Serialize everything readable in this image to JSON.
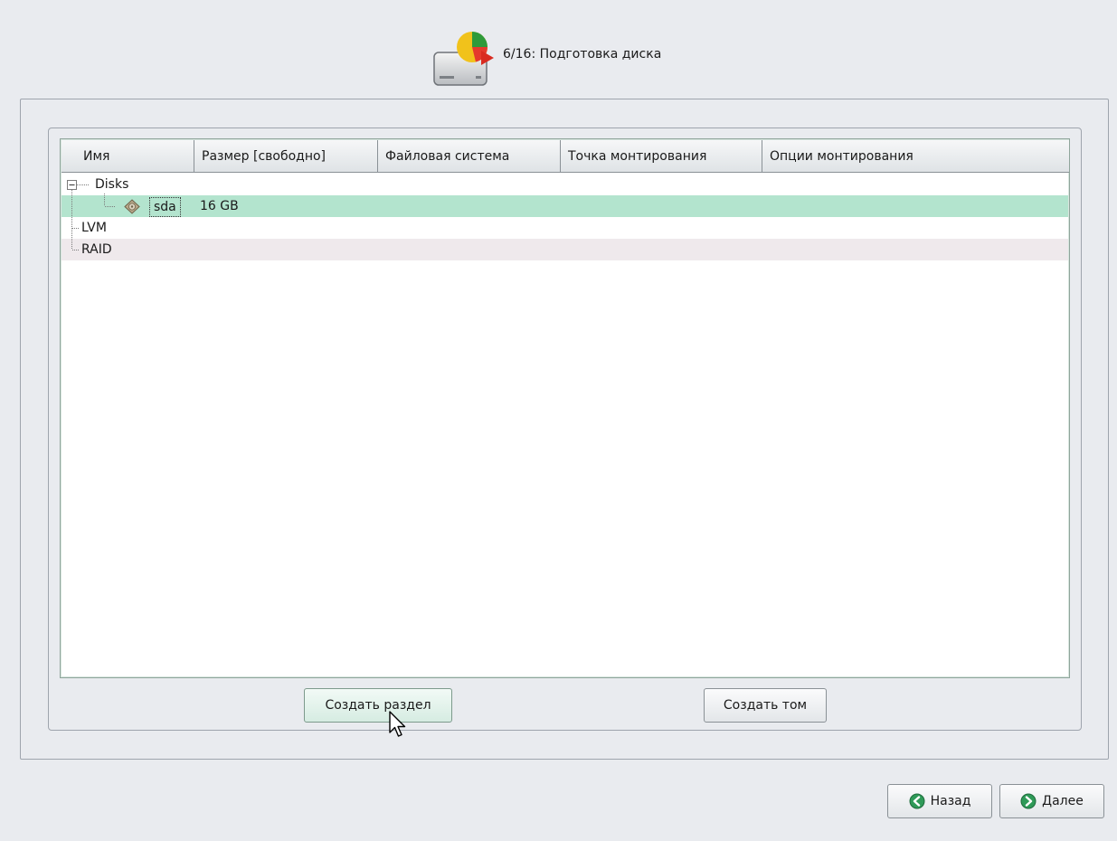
{
  "header": {
    "icon": "disk-partition-icon",
    "title": "6/16: Подготовка диска"
  },
  "table": {
    "columns": [
      "Имя",
      "Размер [свободно]",
      "Файловая система",
      "Точка монтирования",
      "Опции монтирования"
    ],
    "rows": [
      {
        "name": "Disks",
        "size": "",
        "expander": "minus"
      },
      {
        "name": "sda",
        "size": "16 GB",
        "icon": "hard-disk-icon",
        "selected": true
      },
      {
        "name": "LVM",
        "size": ""
      },
      {
        "name": "RAID",
        "size": ""
      }
    ]
  },
  "buttons": {
    "create_partition": "Создать раздел",
    "create_volume": "Создать том",
    "back": "Назад",
    "next": "Далее"
  },
  "colors": {
    "selection": "#b3e4ce",
    "nav_icon": "#2f9a58"
  }
}
